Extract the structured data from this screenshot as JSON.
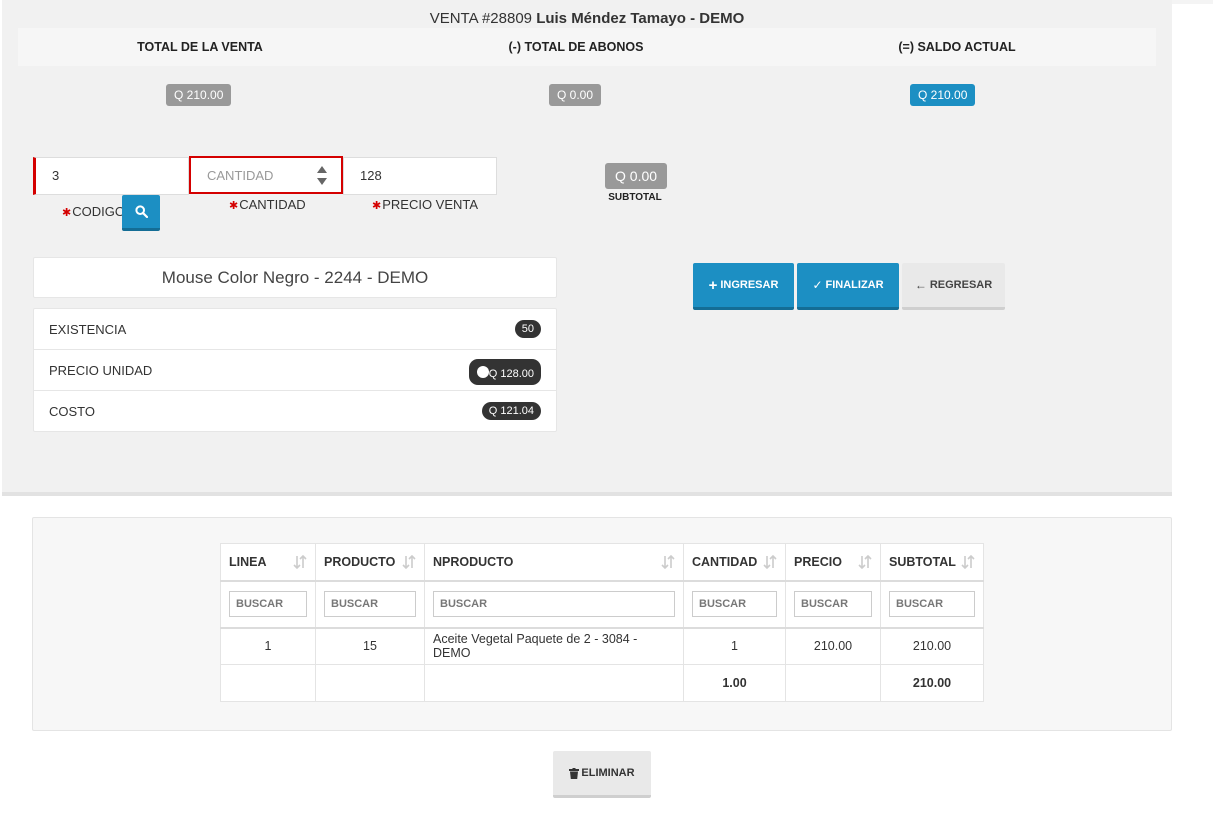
{
  "header": {
    "venta_prefix": "VENTA #28809",
    "customer": "Luis Méndez Tamayo - DEMO"
  },
  "totals": {
    "total_venta_label": "TOTAL DE LA VENTA",
    "total_abonos_label": "(-) TOTAL DE ABONOS",
    "saldo_actual_label": "(=) SALDO ACTUAL",
    "total_venta_value": "Q 210.00",
    "total_abonos_value": "Q 0.00",
    "saldo_actual_value": "Q 210.00",
    "colors": {
      "gray": "#999999",
      "blue": "#1c8fc3"
    }
  },
  "form": {
    "codigo_value": "3",
    "codigo_label": "CODIGO",
    "cantidad_value": "",
    "cantidad_placeholder": "CANTIDAD",
    "cantidad_label": "CANTIDAD",
    "precio_value": "128",
    "precio_label": "PRECIO VENTA",
    "required_mark": "✱",
    "search_icon": "search-icon"
  },
  "subtotal": {
    "value": "Q 0.00",
    "label": "SUBTOTAL"
  },
  "product": {
    "name": "Mouse Color Negro - 2244 - DEMO",
    "existencia_label": "EXISTENCIA",
    "existencia_value": "50",
    "precio_unidad_label": "PRECIO UNIDAD",
    "precio_unidad_value": "Q 128.00",
    "costo_label": "COSTO",
    "costo_value": "Q 121.04"
  },
  "actions": {
    "ingresar_label": "INGRESAR",
    "finalizar_label": "FINALIZAR",
    "regresar_label": "REGRESAR"
  },
  "table": {
    "columns": [
      "LINEA",
      "PRODUCTO",
      "NPRODUCTO",
      "CANTIDAD",
      "PRECIO",
      "SUBTOTAL"
    ],
    "filter_placeholder": "BUSCAR",
    "rows": [
      [
        "1",
        "15",
        "Aceite Vegetal Paquete de 2 - 3084 - DEMO",
        "1",
        "210.00",
        "210.00"
      ]
    ],
    "footer": {
      "cantidad_total": "1.00",
      "subtotal_total": "210.00"
    }
  },
  "delete": {
    "label": "ELIMINAR"
  }
}
